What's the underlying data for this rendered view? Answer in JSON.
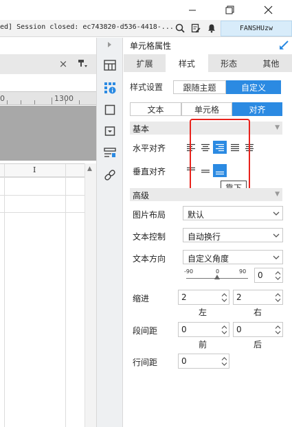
{
  "window": {
    "minimize_glyph": "—",
    "maximize_glyph": "❐",
    "close_glyph": "✕"
  },
  "statusbar": {
    "message": "ed] Session closed: ec743820-d536-4418-...",
    "user": "FANSHUzw"
  },
  "editor": {
    "ruler_numbers": [
      "0",
      "1300"
    ],
    "column_header": "I"
  },
  "panel": {
    "title": "单元格属性",
    "tabs": [
      {
        "label": "扩展",
        "active": false
      },
      {
        "label": "样式",
        "active": true
      },
      {
        "label": "形态",
        "active": false
      },
      {
        "label": "其他",
        "active": false
      }
    ],
    "style_setting": {
      "label": "样式设置",
      "options": [
        "跟随主题",
        "自定义"
      ],
      "selected": "自定义"
    },
    "subtabs": {
      "items": [
        "文本",
        "单元格",
        "对齐"
      ],
      "selected": "对齐"
    },
    "basic": {
      "title": "基本",
      "h_align_label": "水平对齐",
      "v_align_label": "垂直对齐",
      "tooltip": "靠下"
    },
    "advanced": {
      "title": "高级",
      "image_layout": {
        "label": "图片布局",
        "value": "默认"
      },
      "text_control": {
        "label": "文本控制",
        "value": "自动换行"
      },
      "text_direction": {
        "label": "文本方向",
        "value": "自定义角度"
      },
      "angle": {
        "min": "-90",
        "mid": "0",
        "max": "90",
        "value": "0"
      },
      "indent": {
        "label": "缩进",
        "left_value": "2",
        "right_value": "2",
        "left_label": "左",
        "right_label": "右"
      },
      "para_spacing": {
        "label": "段间距",
        "before_value": "0",
        "after_value": "0",
        "before_label": "前",
        "after_label": "后"
      },
      "line_spacing": {
        "label": "行间距",
        "value": "0"
      }
    }
  },
  "colors": {
    "accent": "#2b8ae2",
    "highlight_box": "#e8211b"
  }
}
